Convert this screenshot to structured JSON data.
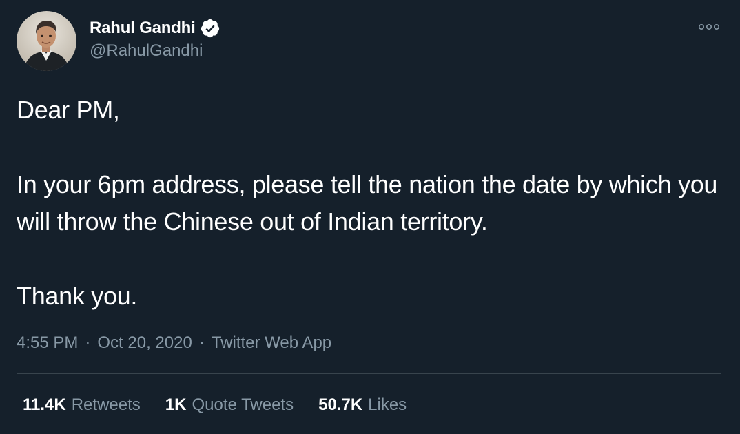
{
  "author": {
    "display_name": "Rahul Gandhi",
    "handle": "@RahulGandhi",
    "verified": true,
    "avatar_icon": "profile-photo",
    "verified_icon": "verified-badge-icon"
  },
  "menu": {
    "icon": "more-options-icon"
  },
  "tweet": {
    "paragraphs": [
      "Dear PM,",
      "In your 6pm address, please tell the nation the date by which you will throw the Chinese out of Indian territory.",
      "Thank you."
    ]
  },
  "meta": {
    "time": "4:55 PM",
    "date": "Oct 20, 2020",
    "source": "Twitter Web App",
    "separator": "·"
  },
  "stats": [
    {
      "count": "11.4K",
      "label": "Retweets"
    },
    {
      "count": "1K",
      "label": "Quote Tweets"
    },
    {
      "count": "50.7K",
      "label": "Likes"
    }
  ],
  "colors": {
    "background": "#15202b",
    "text_primary": "#ffffff",
    "text_secondary": "#8899a6",
    "divider": "#38444d"
  }
}
